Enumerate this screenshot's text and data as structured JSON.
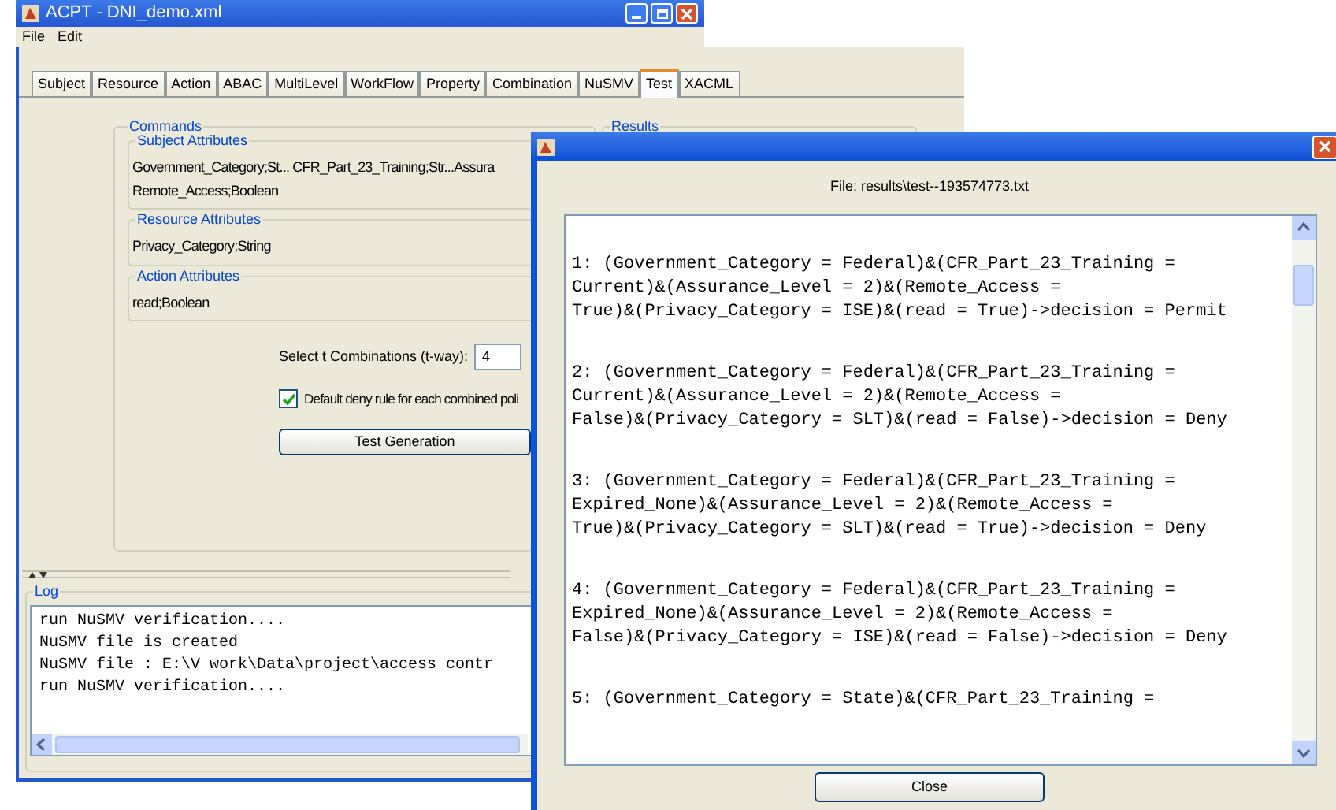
{
  "main_window": {
    "title": "ACPT - DNI_demo.xml",
    "menu": [
      "File",
      "Edit"
    ],
    "tabs": [
      {
        "label": "Subject",
        "selected": false
      },
      {
        "label": "Resource",
        "selected": false
      },
      {
        "label": "Action",
        "selected": false
      },
      {
        "label": "ABAC",
        "selected": false
      },
      {
        "label": "MultiLevel",
        "selected": false
      },
      {
        "label": "WorkFlow",
        "selected": false
      },
      {
        "label": "Property",
        "selected": false
      },
      {
        "label": "Combination",
        "selected": false
      },
      {
        "label": "NuSMV",
        "selected": false
      },
      {
        "label": "Test",
        "selected": true
      },
      {
        "label": "XACML",
        "selected": false
      }
    ],
    "commands": {
      "title": "Commands",
      "groups": [
        {
          "title": "Subject Attributes",
          "lines": [
            "Government_Category;St... CFR_Part_23_Training;Str...Assura",
            "Remote_Access;Boolean"
          ]
        },
        {
          "title": "Resource Attributes",
          "lines": [
            "Privacy_Category;String"
          ]
        },
        {
          "title": "Action Attributes",
          "lines": [
            "read;Boolean"
          ]
        }
      ],
      "t_way": {
        "label": "Select t Combinations (t-way):",
        "value": "4"
      },
      "default_deny": {
        "label": "Default deny rule for each combined poli",
        "checked": true
      },
      "button": "Test Generation"
    },
    "results": {
      "title": "Results"
    },
    "log": {
      "title": "Log",
      "lines": [
        "run NuSMV verification....",
        "NuSMV file is created",
        "NuSMV file : E:\\V work\\Data\\project\\access contr",
        "run NuSMV verification...."
      ]
    }
  },
  "dialog": {
    "file_label": "File: results\\test--193574773.txt",
    "entries": [
      {
        "lines": [
          "1: (Government_Category = Federal)&(CFR_Part_23_Training =",
          "Current)&(Assurance_Level = 2)&(Remote_Access =",
          "True)&(Privacy_Category = ISE)&(read = True)->decision = Permit"
        ]
      },
      {
        "lines": [
          "2: (Government_Category = Federal)&(CFR_Part_23_Training =",
          "Current)&(Assurance_Level = 2)&(Remote_Access =",
          "False)&(Privacy_Category = SLT)&(read = False)->decision = Deny"
        ]
      },
      {
        "lines": [
          "3: (Government_Category = Federal)&(CFR_Part_23_Training =",
          "Expired_None)&(Assurance_Level = 2)&(Remote_Access =",
          "True)&(Privacy_Category = SLT)&(read = True)->decision = Deny"
        ]
      },
      {
        "lines": [
          "4: (Government_Category = Federal)&(CFR_Part_23_Training =",
          "Expired_None)&(Assurance_Level = 2)&(Remote_Access =",
          "False)&(Privacy_Category = ISE)&(read = False)->decision = Deny"
        ]
      },
      {
        "lines": [
          "5: (Government_Category = State)&(CFR_Part_23_Training ="
        ]
      }
    ],
    "button": "Close"
  }
}
